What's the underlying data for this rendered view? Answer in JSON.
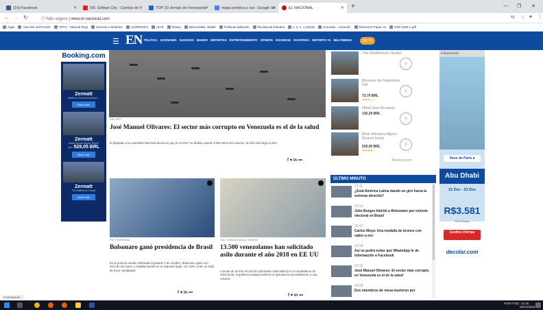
{
  "browser": {
    "tabs": [
      {
        "title": "(14) Facebook",
        "color": "#3b5998"
      },
      {
        "title": "SN. Grithan City - Camisa do",
        "color": "#e62117"
      },
      {
        "title": "TOP 10 Jornais do Venezuela",
        "color": "#1e6bb8"
      },
      {
        "title": "mapa américa s sul - Google Se",
        "color": "#4285f4"
      },
      {
        "title": "EL NACIONAL",
        "color": "#d00000"
      }
    ],
    "new_tab": "+",
    "window_controls": [
      "—",
      "❐",
      "✕"
    ],
    "url_security": "Não seguro",
    "url": "www.el-nacional.com",
    "bookmarks": [
      "Apps",
      "How the 1970 Kenti",
      "TRT4 - Tribunal Regi",
      "Normas e Modelos",
      "COPERVES",
      "ISAP",
      "Rotary",
      "BENJAMIN, Walter",
      "Políticas Editorais",
      "Revista de Estudos",
      "v. 3, n. 1 (2018)",
      "Conexão - Comunic",
      "Research Paper on",
      "R35-1029-1.pdf"
    ]
  },
  "site": {
    "logo": "EN",
    "menu": [
      "POLÍTICA",
      "ECONOMÍA",
      "SUCESOS",
      "MUNDO",
      "DEPORTES",
      "ENTRETENIMIENTO",
      "OPINIÓN",
      "SOCIEDAD",
      "DIÁSPORA",
      "REPORTE YA",
      "MULTIMEDIA"
    ],
    "tv_label": "EN TV"
  },
  "left_ad": {
    "brand": "Booking.com",
    "blocks": [
      {
        "title": "Zermatt",
        "sub": "Matthorn Serviced Apartme...",
        "button": "Book now"
      },
      {
        "title": "Zermatt",
        "sub": "Swiss Modern Alpine Resort",
        "price_from": "from",
        "price": "529,05 BRL",
        "button": "Book now"
      },
      {
        "title": "Zermatt",
        "sub": "The Matterhorn Hostel",
        "button": "Book now"
      }
    ]
  },
  "hero": {
    "caption": "Foto: AFP",
    "headline": "José Manuel Olivares: El sector más corrupto en Venezuela es el de la salud",
    "summary": "El diputado a la Asamblea Nacional denunció que en el 2017 se debían operar 2.500 niños del corazón, la cifra solo llegó a 23%",
    "share": "f  ♥  in   •••"
  },
  "articles": [
    {
      "caption": "Foto: Referencial",
      "headline": "Bolsonaro ganó presidencia de Brasil",
      "summary": "En la primera vuelta celebrada el pasado 7 de octubre, Bolsonaro ganó con 46% de los votos, y Haddad quedó en el segundo lugar, con 29%, entre un total de trece candidatos",
      "share": "f  ♥  in   •••"
    },
    {
      "caption": "Foto: Cortesía Gustavo Sánchez",
      "headline": "13.500 venezolanos han solicitado asilo durante el año 2018 en EE UU",
      "summary": "A pesar de la cifra récord de solicitudes realizadas por los ciudadanos de Venezuela, el gobierno estadounidense le aprueba el procedimiento a una minoría",
      "share": "f  ♥  in   •••"
    }
  ],
  "hotels": [
    {
      "name": "The Matterhorn Hostel",
      "price": "",
      "stars": ""
    },
    {
      "name": "Bivouac de Napoléon GA",
      "price": "73,70 BRL",
      "stars": "★★★☆☆"
    },
    {
      "name": "Hôtel Des Arceaux",
      "price": "130,29 BRL",
      "stars": ""
    },
    {
      "name": "Best Western Alpen Resort Hotel",
      "price": "529,05 BRL",
      "stars": "★★★★☆"
    }
  ],
  "booking_footer": "Booking.com",
  "ultimo_minuto": {
    "title": "ÚLTIMO MINUTO",
    "items": [
      {
        "time": "21:11",
        "title": "¿Está América Latina dando un giro hacia la extrema derecha?"
      },
      {
        "time": "20:53",
        "title": "Julio Borges felicitó a Bolsonaro por victoria electoral en Brasil"
      },
      {
        "time": "20:47",
        "title": "Carlos Moya: Una medalla de bronce con sabor a oro"
      },
      {
        "time": "20:38",
        "title": "Así se podrá evitar que WhatsApp le de información a Facebook"
      },
      {
        "time": "20:22",
        "title": "José Manuel Olivares: El sector más corrupto en Venezuela es el de la salud"
      },
      {
        "time": "20:08",
        "title": "Dos miembros de mesa murieron por"
      }
    ]
  },
  "right_ad": {
    "disponiveis": "6 disponíveis",
    "voos": "Voos de Paris a",
    "city": "Abu Dhabi",
    "dates": "21 Dez - 23 Dez",
    "price": "R$3.581",
    "per_person": "Por Pessoa",
    "cta": "Confira Ofertas",
    "brand": "decolar.com"
  },
  "status": "Conectando...",
  "taskbar": {
    "lang": "POR PTB2",
    "time": "22:36",
    "date": "28/10/2018"
  }
}
